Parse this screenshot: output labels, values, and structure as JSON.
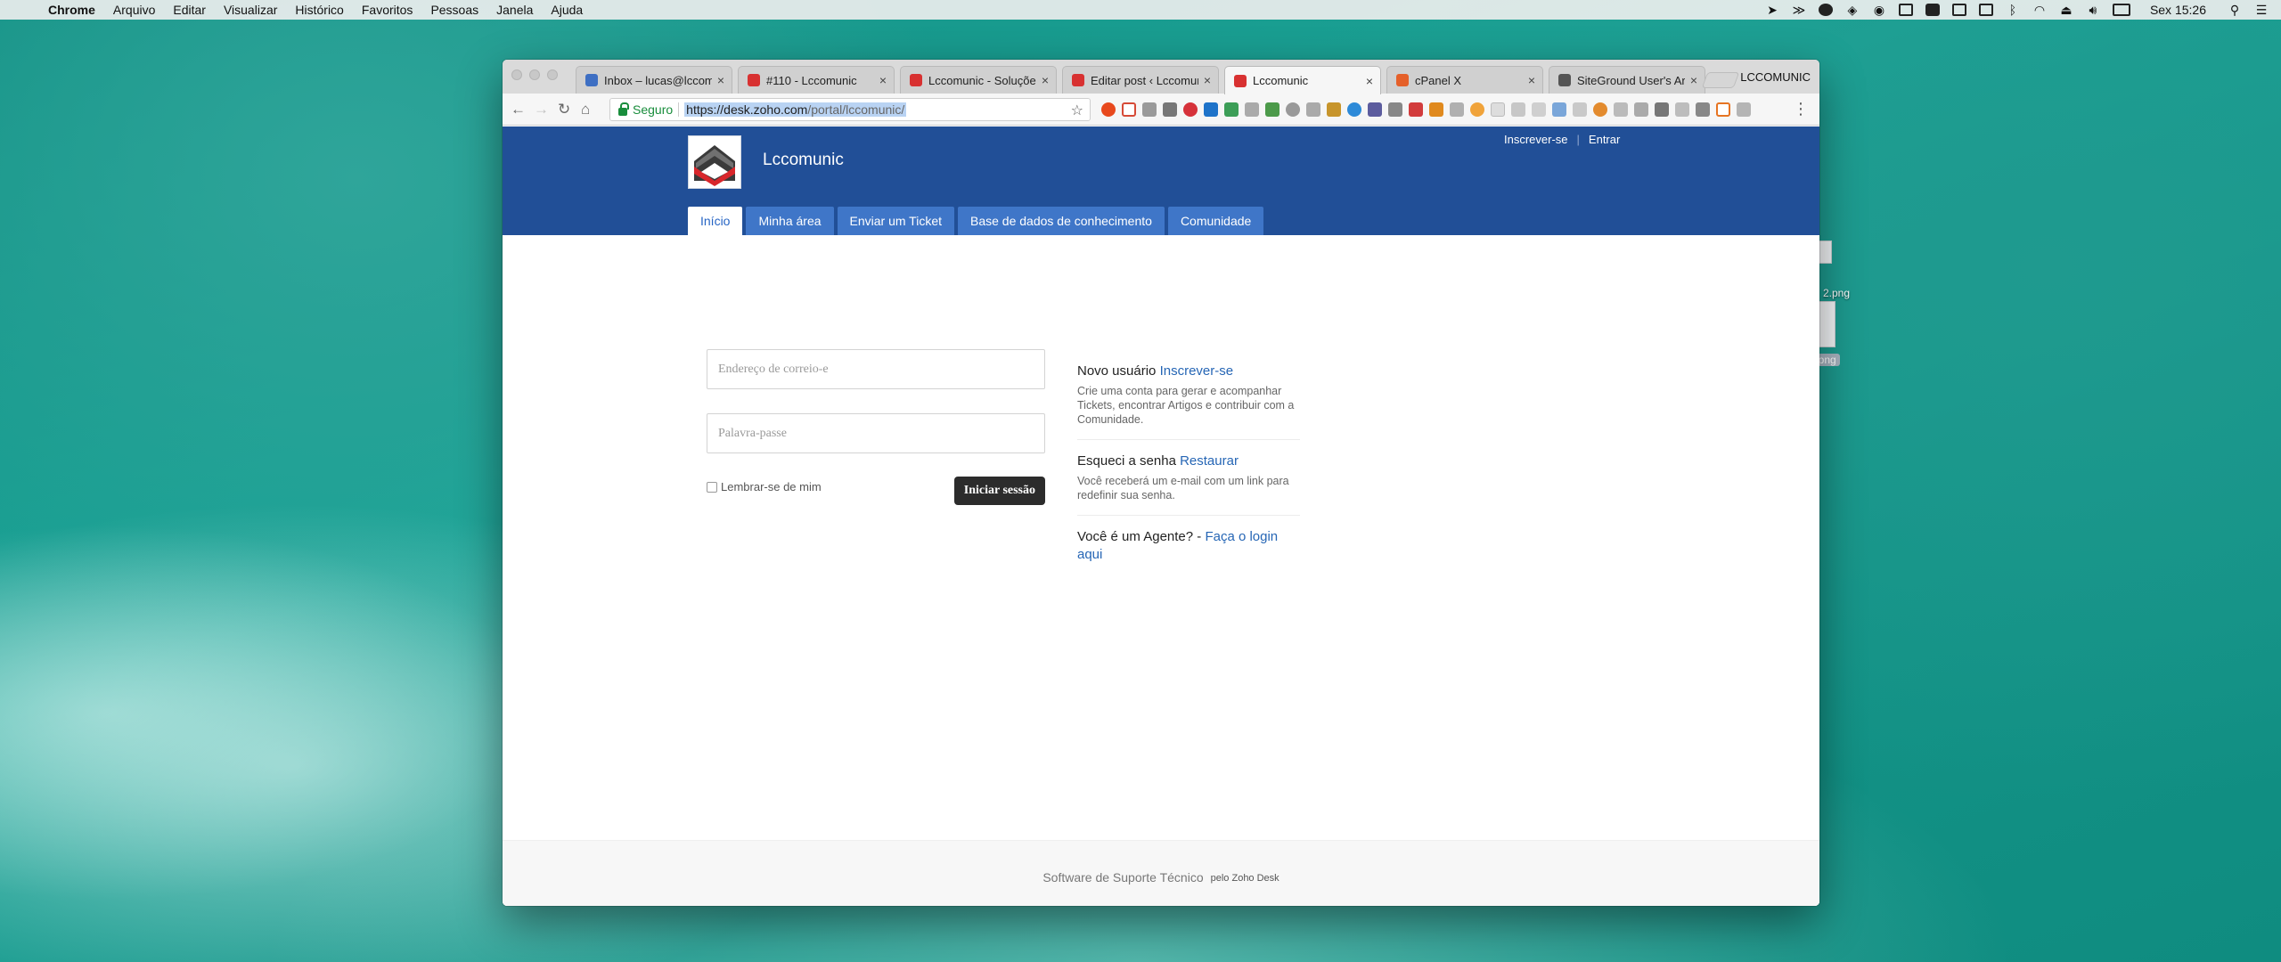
{
  "menubar": {
    "app": "Chrome",
    "items": [
      "Arquivo",
      "Editar",
      "Visualizar",
      "Histórico",
      "Favoritos",
      "Pessoas",
      "Janela",
      "Ajuda"
    ],
    "clock": "Sex 15:26"
  },
  "desktop": {
    "files": [
      {
        "label": "2.png"
      },
      {
        "label": "t.png"
      }
    ]
  },
  "browser": {
    "profile": "LCCOMUNIC",
    "tabs": [
      {
        "title": "Inbox – lucas@lccomu",
        "favicon": "mail-icon",
        "color": "#3e6fc3"
      },
      {
        "title": "#110 - Lccomunic",
        "favicon": "lccomunic-icon",
        "color": "#d83131"
      },
      {
        "title": "Lccomunic - Soluçõe",
        "favicon": "lccomunic-icon",
        "color": "#d83131"
      },
      {
        "title": "Editar post ‹ Lccomun",
        "favicon": "lccomunic-icon",
        "color": "#d83131"
      },
      {
        "title": "Lccomunic",
        "favicon": "lccomunic-icon",
        "color": "#d83131"
      },
      {
        "title": "cPanel X",
        "favicon": "cpanel-icon",
        "color": "#e5602a"
      },
      {
        "title": "SiteGround User's Are",
        "favicon": "siteground-icon",
        "color": "#555555"
      }
    ],
    "omnibox": {
      "secure_label": "Seguro",
      "url_host": "https://desk.zoho.com",
      "url_path": "/portal/lccomunic/"
    }
  },
  "site": {
    "brand": "Lccomunic",
    "top_links": {
      "signup": "Inscrever-se",
      "signin": "Entrar"
    },
    "nav": [
      {
        "label": "Início",
        "active": true
      },
      {
        "label": "Minha área"
      },
      {
        "label": "Enviar um Ticket"
      },
      {
        "label": "Base de dados de conhecimento"
      },
      {
        "label": "Comunidade"
      }
    ],
    "login": {
      "email_placeholder": "Endereço de correio-e",
      "password_placeholder": "Palavra-passe",
      "remember_label": "Lembrar-se de mim",
      "submit_label": "Iniciar sessão"
    },
    "info": {
      "new_user_title": "Novo usuário",
      "new_user_link": "Inscrever-se",
      "new_user_desc": "Crie uma conta para gerar e acompanhar Tickets, encontrar Artigos e contribuir com a Comunidade.",
      "forgot_title": "Esqueci a senha",
      "forgot_link": "Restaurar",
      "forgot_desc": "Você receberá um e-mail com um link para redefinir sua senha.",
      "agent_title": "Você é um Agente? -",
      "agent_link": "Faça o login aqui"
    },
    "footer": {
      "main": "Software de Suporte Técnico",
      "by": "pelo Zoho Desk"
    }
  },
  "colors": {
    "header_bg": "#214f97",
    "nav_tab_bg": "#3f76c8",
    "link": "#2666b5",
    "secure": "#198d3c"
  }
}
